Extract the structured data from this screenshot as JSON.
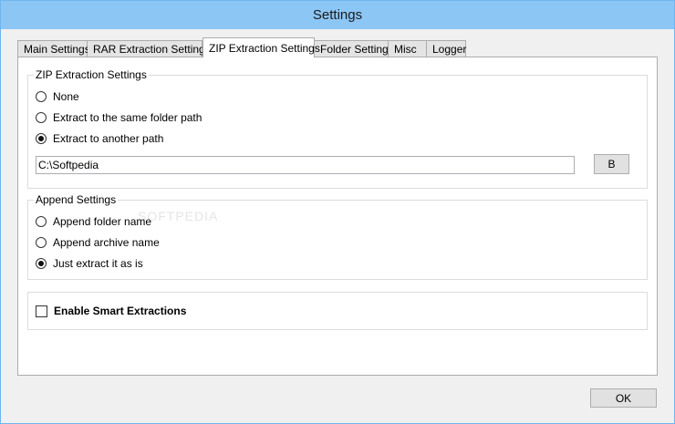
{
  "window": {
    "title": "Settings"
  },
  "tabs": [
    {
      "label": "Main Settings",
      "active": false
    },
    {
      "label": "RAR Extraction Settings",
      "active": false
    },
    {
      "label": "ZIP Extraction Settings",
      "active": true
    },
    {
      "label": "Folder Settings",
      "active": false
    },
    {
      "label": "Misc",
      "active": false
    },
    {
      "label": "Logger",
      "active": false
    }
  ],
  "zip_group": {
    "legend": "ZIP Extraction Settings",
    "options": [
      {
        "label": "None",
        "checked": false
      },
      {
        "label": "Extract to the same folder path",
        "checked": false
      },
      {
        "label": "Extract to another path",
        "checked": true
      }
    ],
    "path_value": "C:\\Softpedia",
    "browse_label": "B"
  },
  "append_group": {
    "legend": "Append Settings",
    "options": [
      {
        "label": "Append folder name",
        "checked": false
      },
      {
        "label": "Append archive name",
        "checked": false
      },
      {
        "label": "Just extract it as is",
        "checked": true
      }
    ],
    "watermark": "SOFTPEDIA"
  },
  "smart_group": {
    "checkbox_label": "Enable Smart Extractions",
    "checked": false
  },
  "footer": {
    "ok_label": "OK"
  }
}
